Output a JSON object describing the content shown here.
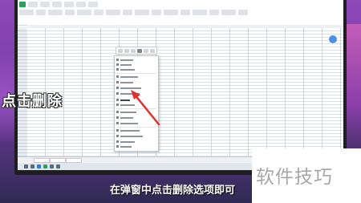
{
  "overlay": {
    "callout_text": "点击删除",
    "subtitle": "在弹窗中点击删除选项即可",
    "watermark": "软件技巧"
  },
  "colors": {
    "background_purple": "#8e48b8",
    "highlight_arrow": "#e03030",
    "spreadsheet_green": "#2f9e5c",
    "float_button_blue": "#4c90e6"
  },
  "icons": {
    "float_button": "circle-icon",
    "arrow": "red-arrow-icon"
  }
}
